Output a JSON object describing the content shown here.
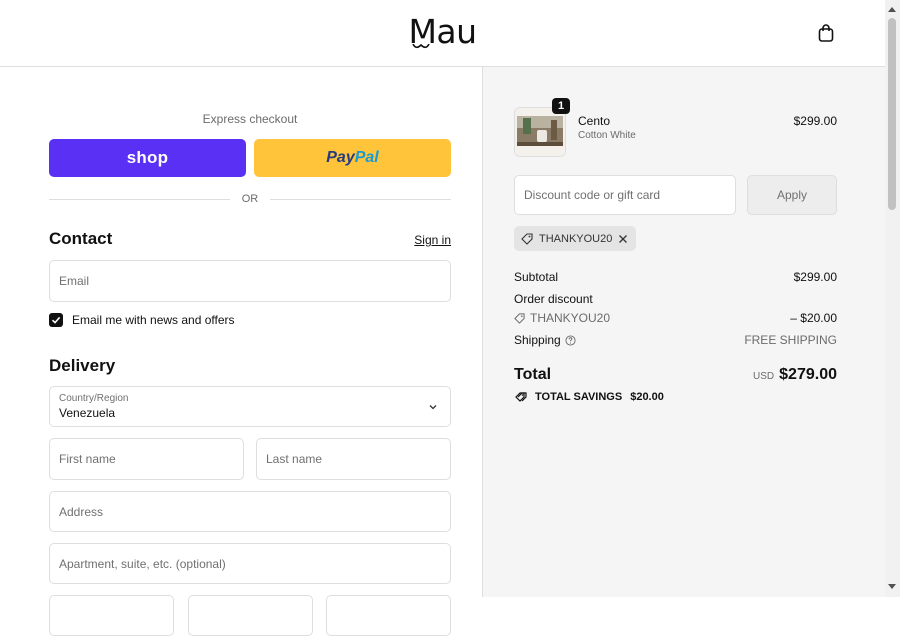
{
  "header": {
    "logo_text": "Mau",
    "bag_icon": "shopping-bag-icon"
  },
  "express": {
    "label": "Express checkout",
    "shop_label": "shop",
    "paypal_pay": "Pay",
    "paypal_pal": "Pal",
    "or_text": "OR",
    "colors": {
      "shop": "#5a31f4",
      "paypal": "#ffc439"
    }
  },
  "contact": {
    "title": "Contact",
    "signin": "Sign in",
    "email_placeholder": "Email",
    "newsletter_label": "Email me with news and offers",
    "newsletter_checked": true
  },
  "delivery": {
    "title": "Delivery",
    "country_label": "Country/Region",
    "country_value": "Venezuela",
    "first_name_placeholder": "First name",
    "last_name_placeholder": "Last name",
    "address_placeholder": "Address",
    "apartment_placeholder": "Apartment, suite, etc. (optional)"
  },
  "order": {
    "item": {
      "name": "Cento",
      "variant": "Cotton White",
      "price": "$299.00",
      "quantity": "1"
    },
    "discount_placeholder": "Discount code or gift card",
    "apply_label": "Apply",
    "applied_code": "THANKYOU20",
    "summary": {
      "subtotal_label": "Subtotal",
      "subtotal_value": "$299.00",
      "order_discount_label": "Order discount",
      "discount_code": "THANKYOU20",
      "discount_value": "– $20.00",
      "shipping_label": "Shipping",
      "shipping_value": "FREE SHIPPING",
      "total_label": "Total",
      "currency": "USD",
      "total_value": "$279.00",
      "savings_label": "TOTAL SAVINGS",
      "savings_value": "$20.00"
    }
  }
}
